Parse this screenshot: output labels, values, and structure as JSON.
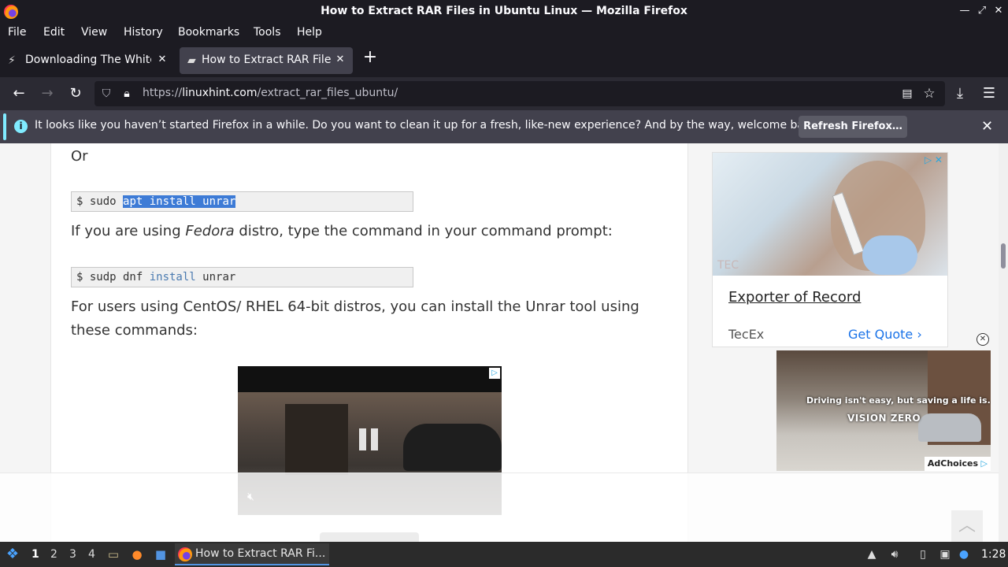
{
  "window": {
    "title": "How to Extract RAR Files in Ubuntu Linux — Mozilla Firefox"
  },
  "menu": [
    "File",
    "Edit",
    "View",
    "History",
    "Bookmarks",
    "Tools",
    "Help"
  ],
  "tabs": [
    {
      "label": "Downloading The White Rabbit",
      "active": false
    },
    {
      "label": "How to Extract RAR Files in Ubuntu Linux",
      "active": true
    }
  ],
  "urlbar": {
    "prefix": "https://",
    "domain": "linuxhint.com",
    "path": "/extract_rar_files_ubuntu/"
  },
  "notification": {
    "message": "It looks like you haven’t started Firefox in a while. Do you want to clean it up for a fresh, like-new experience? And by the way, welcome back!",
    "button": "Refresh Firefox…"
  },
  "article": {
    "or_text": "Or",
    "code1": {
      "prompt": "$ sudo ",
      "selected": "apt install unrar"
    },
    "fedora_before": "If you are using ",
    "fedora_em": "Fedora",
    "fedora_after": " distro, type the command in your command prompt:",
    "code2": {
      "prompt": "$ sudp dnf ",
      "keyword": "install",
      "rest": " unrar"
    },
    "centos_line1": "For users using CentOS/ RHEL 64-bit distros, you can install the Unrar tool using",
    "centos_line2": "these commands:"
  },
  "sidebar_ad": {
    "brand": "TEC",
    "headline": "Exporter of Record",
    "sponsor": "TecEx",
    "cta": "Get Quote"
  },
  "corner_ad": {
    "caption": "Driving isn't easy, but saving a life is.",
    "logo": "VISION ZERO",
    "adchoices": "AdChoices"
  },
  "taskbar": {
    "workspaces": [
      "1",
      "2",
      "3",
      "4"
    ],
    "active_window": "How to Extract RAR Fi...",
    "clock": "1:28"
  }
}
